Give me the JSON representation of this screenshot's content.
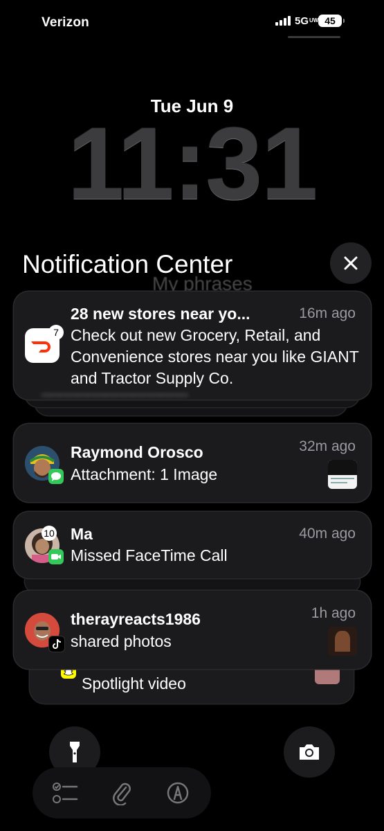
{
  "status_bar": {
    "carrier": "Verizon",
    "network": "5G",
    "network_suffix": "UW",
    "battery": "45"
  },
  "lock": {
    "date": "Tue Jun 9",
    "time": "11:31"
  },
  "notification_center": {
    "title": "Notification Center",
    "close_icon": "close-icon"
  },
  "background_text": {
    "phrases": "My phrases"
  },
  "notifications": [
    {
      "app": "DoorDash",
      "badge": "7",
      "title": "28 new stores near yo...",
      "time": "16m ago",
      "body": "Check out new Grocery, Retail, and Convenience stores near you like GIANT and Tractor Supply Co.",
      "icon": "doordash-icon",
      "accent": "#ff3008"
    },
    {
      "app": "Messages",
      "title": "Raymond Orosco",
      "time": "32m ago",
      "body": "Attachment: 1 Image",
      "icon": "messages-icon",
      "accent": "#34c759"
    },
    {
      "app": "FaceTime",
      "badge": "10",
      "title": "Ma",
      "time": "40m ago",
      "body": "Missed FaceTime Call",
      "icon": "facetime-icon",
      "accent": "#34c759"
    },
    {
      "app": "TikTok",
      "title": "therayreacts1986",
      "time": "1h ago",
      "body": "shared photos",
      "icon": "tiktok-icon"
    },
    {
      "app": "Snapchat",
      "body": "Spotlight video",
      "icon": "snapchat-icon",
      "accent": "#fffc00"
    }
  ],
  "controls": {
    "flashlight_icon": "flashlight-icon",
    "camera_icon": "camera-icon",
    "dock_icons": [
      "checklist-icon",
      "paperclip-icon",
      "compass-icon"
    ]
  }
}
